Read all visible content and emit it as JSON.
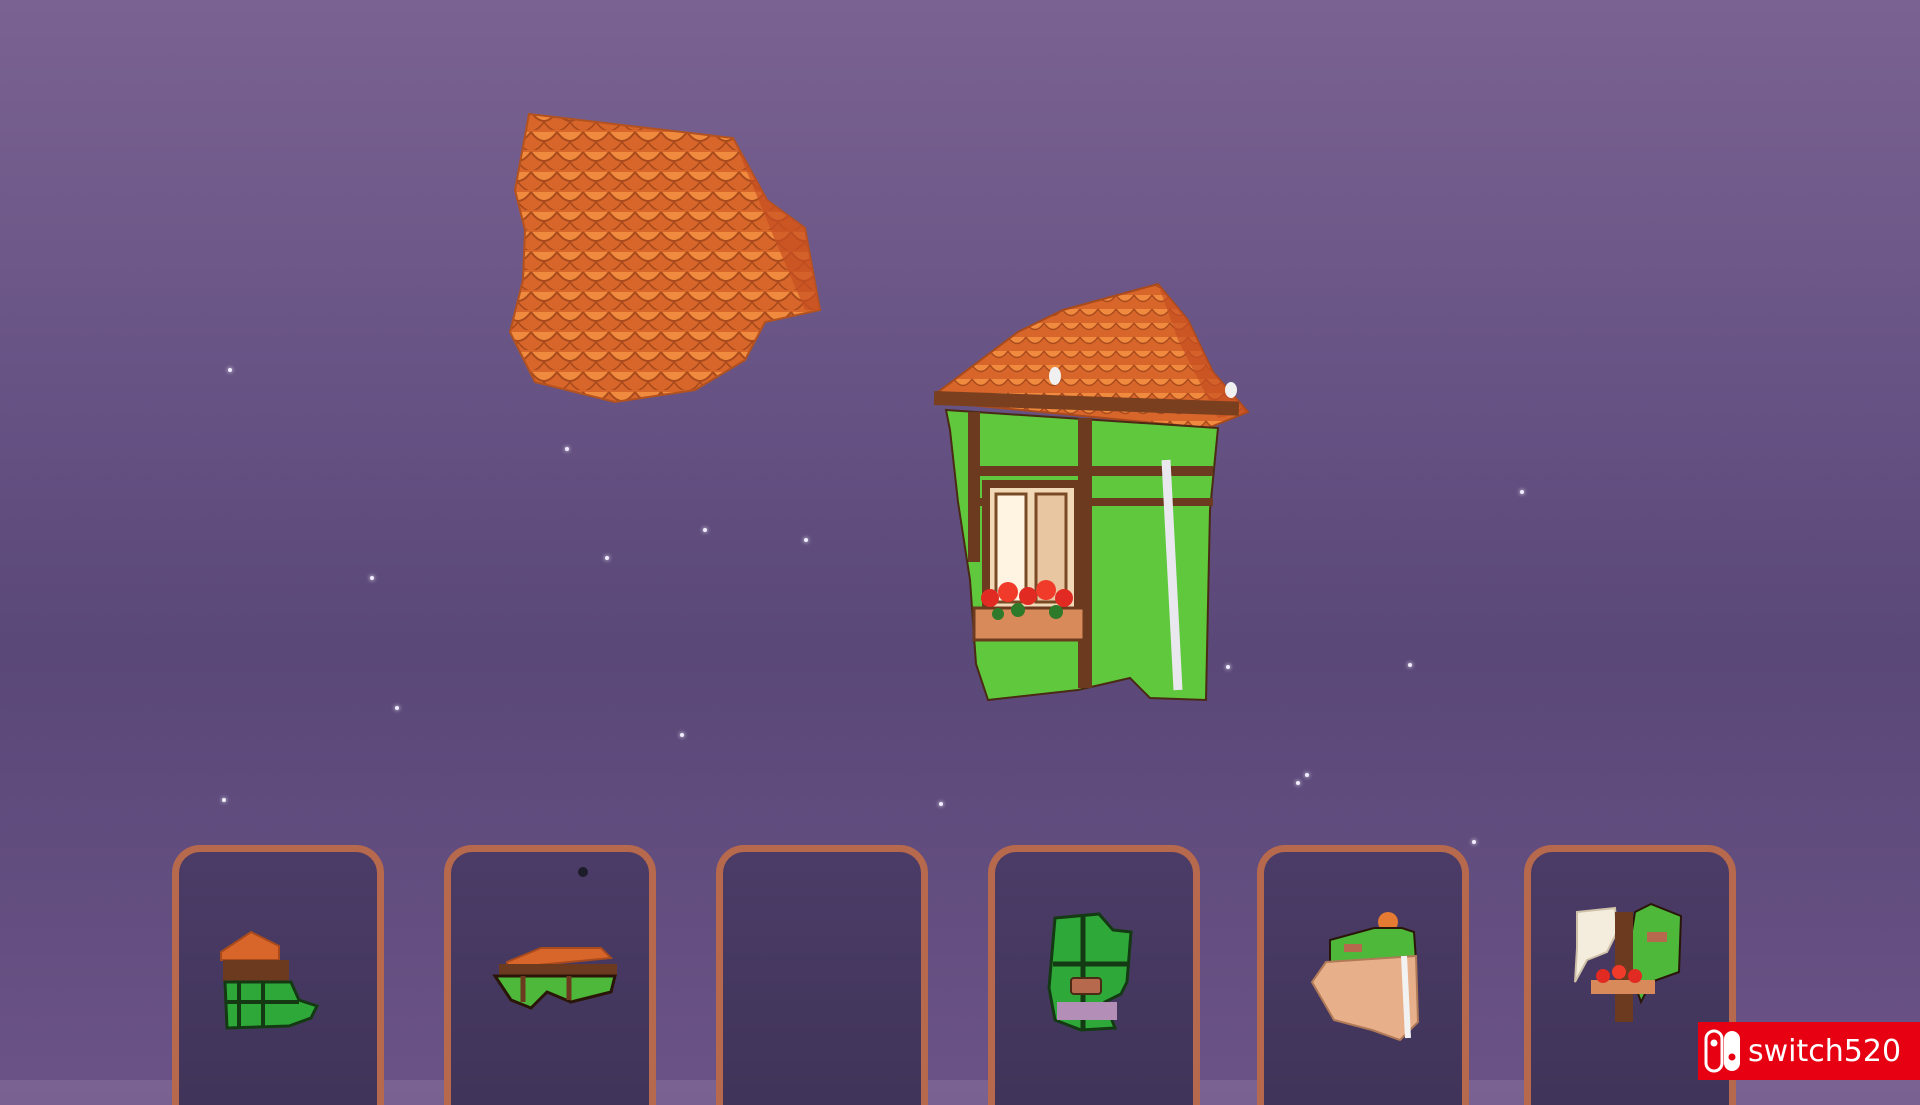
{
  "scene": {
    "background_top": "#7a6392",
    "background_bottom": "#5a4878",
    "roof_color": "#e57a32",
    "wall_color": "#5fc83c",
    "timber_color": "#6b3a1f",
    "tray_border_color": "#b6694c"
  },
  "floating_pieces": [
    {
      "name": "roof-tile-piece",
      "icon": "roof-tiles"
    },
    {
      "name": "house-window-piece",
      "icon": "house-with-flower-box"
    }
  ],
  "piece_tray": {
    "slots": [
      {
        "name": "tray-slot-1",
        "content": "roof-and-green-wall-piece"
      },
      {
        "name": "tray-slot-2",
        "content": "roof-edge-piece"
      },
      {
        "name": "tray-slot-3",
        "content": "empty"
      },
      {
        "name": "tray-slot-4",
        "content": "green-wall-sign-piece"
      },
      {
        "name": "tray-slot-5",
        "content": "brick-wall-piece"
      },
      {
        "name": "tray-slot-6",
        "content": "white-wall-flower-piece"
      }
    ]
  },
  "watermark": {
    "text": "switch520",
    "icon": "nintendo-switch-logo",
    "color": "#e60012"
  }
}
